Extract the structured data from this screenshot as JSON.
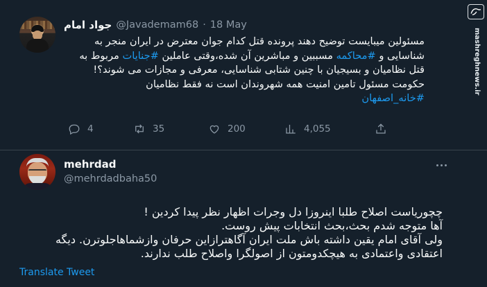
{
  "tweet1": {
    "display_name": "جواد امام",
    "handle": "@Javademam68",
    "separator": "·",
    "date": "18 May",
    "text_lines": [
      "مسئولین میبایست توضیح دهند پرونده قتل کدام جوان معترض در ایران منجر به",
      "شناسایی و #محاکمه مسببین و مباشرین آن شده،وقتی عاملین #جنایات مربوط به",
      "قتل نظامیان و بسیجیان با چنین شتابی شناسایی، معرفی و مجازات می شوند؟!",
      "حکومت مسئول تامین امنیت همه شهروندان است نه فقط نظامیان"
    ],
    "line1": "مسئولین میبایست توضیح دهند پرونده قتل کدام جوان معترض در ایران منجر به",
    "line2_a": "شناسایی و ",
    "line2_tag1": "#محاکمه",
    "line2_b": " مسببین و مباشرین آن شده،وقتی عاملین ",
    "line2_tag2": "#جنایات",
    "line2_c": " مربوط به",
    "line3": "قتل نظامیان و بسیجیان با چنین شتابی شناسایی، معرفی و مجازات می شوند؟!",
    "line4": "حکومت مسئول تامین امنیت همه شهروندان است نه فقط نظامیان",
    "line5_tag": "#خانه_اصفهان",
    "stats": {
      "replies": "4",
      "retweets": "35",
      "likes": "200",
      "views": "4,055"
    }
  },
  "tweet2": {
    "display_name": "mehrdad",
    "handle": "@mehrdadbaha50",
    "text_lines": [
      "چچوریاست اصلاح طلبا اینروزا دل وجرات اظهار نظر پیدا کردین !",
      "آها متوجه شدم بحث،بحث انتخابات پیش روست.",
      "ولی آقای امام یقین داشته باش ملت ایران آگاهترازاین حرفان وازشماهاجلوترن. دیگه",
      "اعتقادی واعتمادی به هیچکدومتون از اصولگرا واصلاح طلب ندارند."
    ],
    "translate_label": "Translate Tweet"
  },
  "watermark": {
    "logo_text": "مشرق",
    "site": "mashreghnews.ir"
  },
  "icons": [
    "reply-icon",
    "retweet-icon",
    "like-icon",
    "views-icon",
    "share-icon",
    "more-icon"
  ],
  "colors": {
    "background": "#15202b",
    "text": "#f7f9f9",
    "muted": "#8b98a5",
    "accent": "#1d9bf0",
    "divider": "#38444d"
  }
}
